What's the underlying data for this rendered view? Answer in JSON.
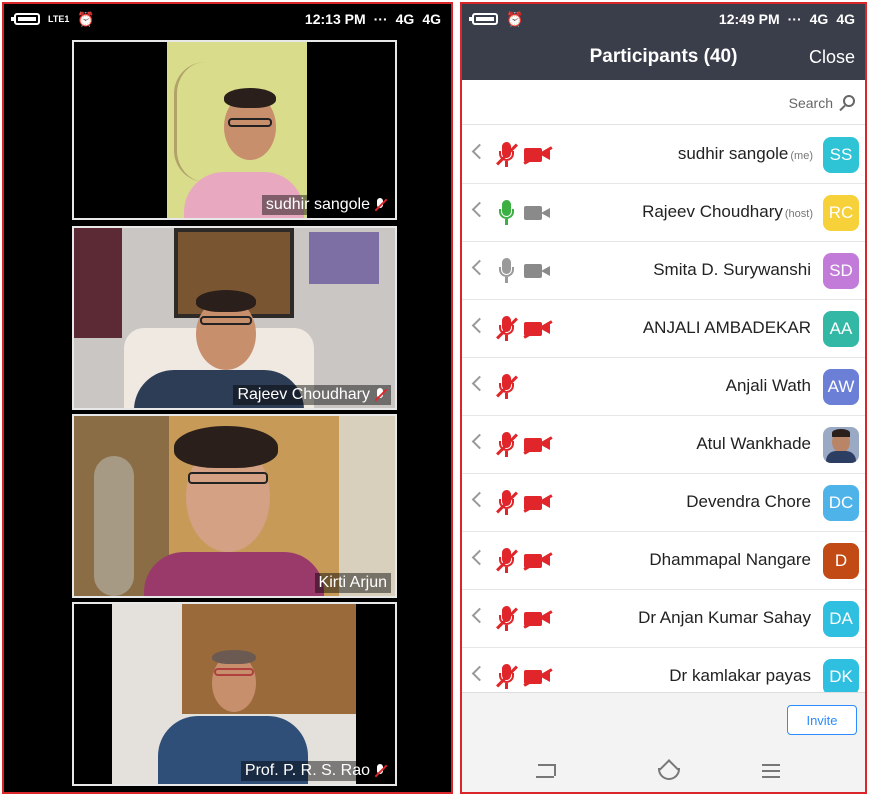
{
  "left_phone": {
    "status": {
      "time": "12:13 PM",
      "network_left": "4G",
      "network_right": "4G",
      "lte_label": "LTE1",
      "volte_label": "Vo)",
      "dots": "···"
    },
    "videos": [
      {
        "name": "sudhir sangole",
        "muted": true
      },
      {
        "name": "Rajeev Choudhary",
        "muted": true
      },
      {
        "name": "Kirti Arjun",
        "muted": false
      },
      {
        "name": "Prof. P. R. S. Rao",
        "muted": true
      }
    ]
  },
  "right_phone": {
    "status": {
      "time": "12:49 PM",
      "network_left": "4G",
      "network_right": "4G",
      "dots": "···"
    },
    "header": {
      "title": "Participants (40)",
      "close_label": "Close"
    },
    "search": {
      "placeholder": "Search"
    },
    "participants": [
      {
        "initials": "SS",
        "name": "sudhir sangole",
        "tag": "(me)",
        "color": "#2ec4d6",
        "mic": "muted",
        "video": "off"
      },
      {
        "initials": "RC",
        "name": "Rajeev Choudhary",
        "tag": "(host)",
        "color": "#f7d13a",
        "mic": "active",
        "video": "on"
      },
      {
        "initials": "SD",
        "name": "Smita D. Surywanshi",
        "tag": "",
        "color": "#c27bd8",
        "mic": "on",
        "video": "on"
      },
      {
        "initials": "AA",
        "name": "ANJALI AMBADEKAR",
        "tag": "",
        "color": "#33b8a6",
        "mic": "muted",
        "video": "off"
      },
      {
        "initials": "AW",
        "name": "Anjali Wath",
        "tag": "",
        "color": "#6b7fd6",
        "mic": "muted",
        "video": "none"
      },
      {
        "initials": "",
        "name": "Atul Wankhade",
        "tag": "",
        "color": "#9aa9c4",
        "mic": "muted",
        "video": "off",
        "photo": true
      },
      {
        "initials": "DC",
        "name": "Devendra Chore",
        "tag": "",
        "color": "#4db3e8",
        "mic": "muted",
        "video": "off"
      },
      {
        "initials": "D",
        "name": "Dhammapal Nangare",
        "tag": "",
        "color": "#c24a14",
        "mic": "muted",
        "video": "off"
      },
      {
        "initials": "DA",
        "name": "Dr Anjan Kumar Sahay",
        "tag": "",
        "color": "#2fbfe0",
        "mic": "muted",
        "video": "off"
      },
      {
        "initials": "DK",
        "name": "Dr kamlakar payas",
        "tag": "",
        "color": "#2fbfe0",
        "mic": "muted",
        "video": "off"
      }
    ],
    "invite_label": "Invite"
  },
  "colors": {
    "border": "#d9262b",
    "zoom_bar": "#3a3e4a",
    "zoom_blue": "#2d8cff",
    "mute_red": "#e0262b",
    "mic_green": "#3cb043"
  }
}
